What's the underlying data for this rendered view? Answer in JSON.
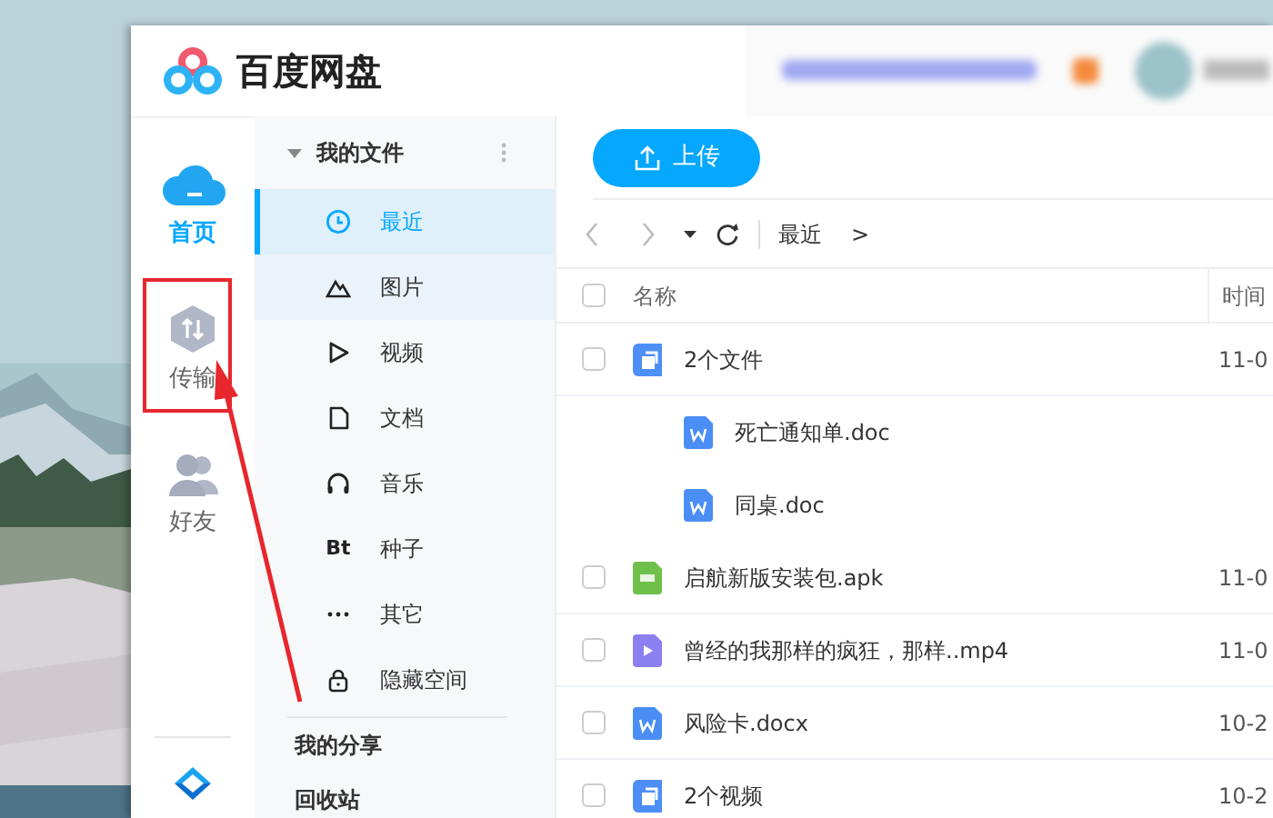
{
  "app": {
    "title": "百度网盘"
  },
  "nav": [
    {
      "label": "首页",
      "selected": true
    },
    {
      "label": "传输",
      "selected": false
    },
    {
      "label": "好友",
      "selected": false
    }
  ],
  "sidebar": {
    "section": "我的文件",
    "items": [
      {
        "label": "最近",
        "selected": true,
        "hovered": false
      },
      {
        "label": "图片",
        "selected": false,
        "hovered": true
      },
      {
        "label": "视频",
        "selected": false,
        "hovered": false
      },
      {
        "label": "文档",
        "selected": false,
        "hovered": false
      },
      {
        "label": "音乐",
        "selected": false,
        "hovered": false
      },
      {
        "label": "种子",
        "glyph": "Bt",
        "selected": false,
        "hovered": false
      },
      {
        "label": "其它",
        "selected": false,
        "hovered": false
      },
      {
        "label": "隐藏空间",
        "selected": false,
        "hovered": false
      }
    ],
    "links": [
      "我的分享",
      "回收站"
    ]
  },
  "toolbar": {
    "upload": "上传",
    "breadcrumb": "最近",
    "separator": ">"
  },
  "table": {
    "columns": [
      "名称",
      "时间"
    ],
    "all_checked": false,
    "rows": [
      {
        "kind": "group",
        "name": "2个文件",
        "time": "11-0",
        "checked": false,
        "children": [
          {
            "kind": "word",
            "name": "死亡通知单.doc"
          },
          {
            "kind": "word",
            "name": "同桌.doc"
          }
        ]
      },
      {
        "kind": "apk",
        "name": "启航新版安装包.apk",
        "time": "11-0",
        "checked": false
      },
      {
        "kind": "video",
        "name": "曾经的我那样的疯狂，那样..mp4",
        "time": "11-0",
        "checked": false
      },
      {
        "kind": "word",
        "name": "风险卡.docx",
        "time": "10-2",
        "checked": false
      },
      {
        "kind": "group",
        "name": "2个视频",
        "time": "10-2",
        "checked": false
      }
    ]
  }
}
